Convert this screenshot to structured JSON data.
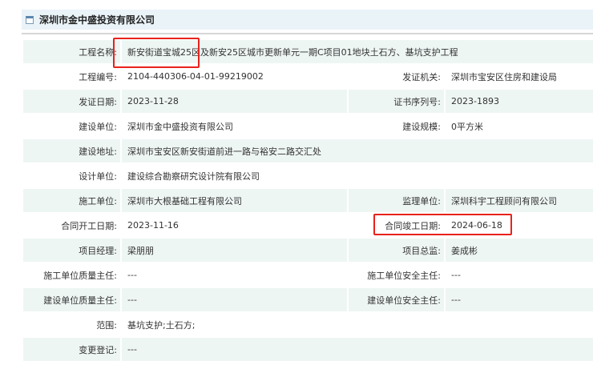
{
  "header": {
    "title": "深圳市金中盛投资有限公司",
    "icon": "panel-icon"
  },
  "rows": [
    {
      "full": true,
      "label": "工程名称:",
      "value": "新安街道宝城25区及新安25区城市更新单元一期C项目01地块土石方、基坑支护工程"
    },
    {
      "label": "工程编号:",
      "value": "2104-440306-04-01-99219002",
      "label2": "发证机关:",
      "value2": "深圳市宝安区住房和建设局"
    },
    {
      "label": "发证日期:",
      "value": "2023-11-28",
      "label2": "证书序列号:",
      "value2": "2023-1893"
    },
    {
      "label": "建设单位:",
      "value": "深圳市金中盛投资有限公司",
      "label2": "建设规模:",
      "value2": "0平方米"
    },
    {
      "full": true,
      "label": "建设地址:",
      "value": "深圳市宝安区新安街道前进一路与裕安二路交汇处"
    },
    {
      "full": true,
      "label": "设计单位:",
      "value": "建设综合勘察研究设计院有限公司"
    },
    {
      "label": "施工单位:",
      "value": "深圳市大根基础工程有限公司",
      "label2": "监理单位:",
      "value2": "深圳科宇工程顾问有限公司"
    },
    {
      "label": "合同开工日期:",
      "value": "2023-11-16",
      "label2": "合同竣工日期:",
      "value2": "2024-06-18"
    },
    {
      "label": "项目经理:",
      "value": "梁朋朋",
      "label2": "项目总监:",
      "value2": "姜成彬"
    },
    {
      "label": "施工单位质量主任:",
      "value": "---",
      "label2": "施工单位安全主任:",
      "value2": "---"
    },
    {
      "label": "建设单位质量主任:",
      "value": "---",
      "label2": "建设单位安全主任:",
      "value2": "---"
    },
    {
      "full": true,
      "label": "范围:",
      "value": "基坑支护;土石方;"
    },
    {
      "full": true,
      "label": "变更登记:",
      "value": "---"
    }
  ],
  "highlight_color": "#e8221b"
}
